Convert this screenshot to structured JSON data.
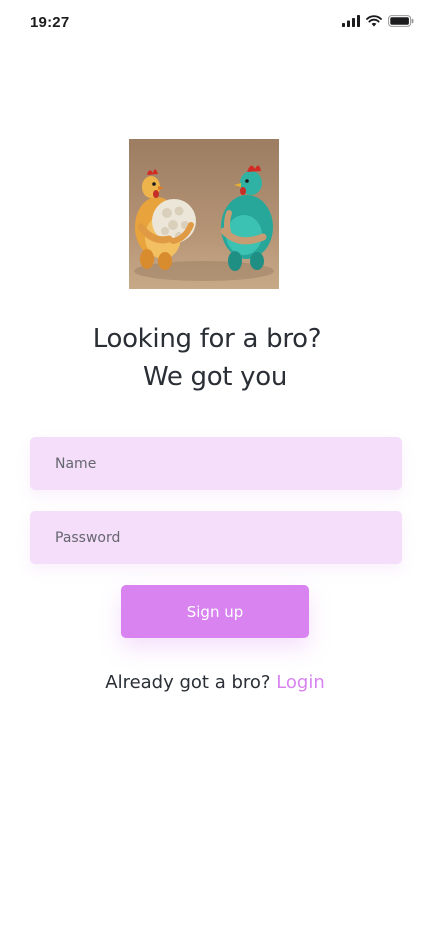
{
  "status_bar": {
    "time": "19:27",
    "icons": [
      "cellular-signal-icon",
      "wifi-icon",
      "battery-icon"
    ]
  },
  "hero": {
    "icon": "chicken-bros-illustration"
  },
  "headline": {
    "line1": "Looking for a bro?",
    "line2": "We got you"
  },
  "form": {
    "name_placeholder": "Name",
    "password_placeholder": "Password",
    "signup_label": "Sign up"
  },
  "login": {
    "prompt": "Already got a bro?",
    "link_label": "Login"
  },
  "colors": {
    "accent": "#d883f0",
    "field_background": "#f4def9",
    "text_dark": "#2a2f36"
  }
}
